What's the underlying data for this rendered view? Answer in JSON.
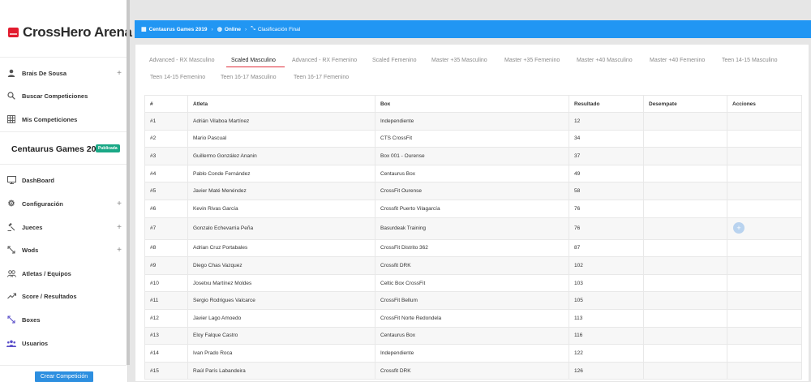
{
  "brand": {
    "name": "CrossHero Arena"
  },
  "sidebar": {
    "user_name": "Brais De Sousa",
    "search_label": "Buscar Competiciones",
    "my_comps_label": "Mis Competiciones",
    "competition_title": "Centaurus Games 2019",
    "competition_badge": "Publicada",
    "items": [
      {
        "label": "DashBoard",
        "icon": "monitor-icon",
        "expandable": false
      },
      {
        "label": "Configuración",
        "icon": "gear-icon",
        "expandable": true
      },
      {
        "label": "Jueces",
        "icon": "gavel-icon",
        "expandable": true
      },
      {
        "label": "Wods",
        "icon": "expand-arrows-icon",
        "expandable": true
      },
      {
        "label": "Atletas / Equipos",
        "icon": "people-icon",
        "expandable": false
      },
      {
        "label": "Score / Resultados",
        "icon": "trending-icon",
        "expandable": false
      },
      {
        "label": "Boxes",
        "icon": "box-arrows-icon",
        "expandable": false
      },
      {
        "label": "Usuarios",
        "icon": "group-icon",
        "expandable": false
      }
    ],
    "create_button": "Crear Competición"
  },
  "breadcrumb": {
    "competition": "Centaurus Games 2019",
    "mode": "Online",
    "current": "Clasificación Final"
  },
  "tabs": [
    {
      "label": "Advanced - RX Masculino",
      "active": false
    },
    {
      "label": "Scaled Masculino",
      "active": true
    },
    {
      "label": "Advanced - RX Femenino",
      "active": false
    },
    {
      "label": "Scaled Femenino",
      "active": false
    },
    {
      "label": "Master +35 Masculino",
      "active": false
    },
    {
      "label": "Master +35 Femenino",
      "active": false
    },
    {
      "label": "Master +40 Masculino",
      "active": false
    },
    {
      "label": "Master +40 Femenino",
      "active": false
    },
    {
      "label": "Teen 14-15 Masculino",
      "active": false
    },
    {
      "label": "Teen 14-15 Femenino",
      "active": false
    },
    {
      "label": "Teen 16-17 Masculino",
      "active": false
    },
    {
      "label": "Teen 16-17 Femenino",
      "active": false
    }
  ],
  "table": {
    "headers": [
      "#",
      "Atleta",
      "Box",
      "Resultado",
      "Desempate",
      "Acciones"
    ],
    "rows": [
      {
        "pos": "#1",
        "athlete": "Adrián Vilaboa Martínez",
        "box": "Independiente",
        "result": "12"
      },
      {
        "pos": "#2",
        "athlete": "Mario Pascual",
        "box": "CTS CrossFit",
        "result": "34"
      },
      {
        "pos": "#3",
        "athlete": "Guillermo González Ananin",
        "box": "Box 001 - Ourense",
        "result": "37"
      },
      {
        "pos": "#4",
        "athlete": "Pablo Conde Fernández",
        "box": "Centaurus Box",
        "result": "49"
      },
      {
        "pos": "#5",
        "athlete": "Javier Maté Menéndez",
        "box": "CrossFit Ourense",
        "result": "58"
      },
      {
        "pos": "#6",
        "athlete": "Kevin Rivas García",
        "box": "Crossfit Puerto Vilagarcía",
        "result": "76"
      },
      {
        "pos": "#7",
        "athlete": "Gonzalo Echevarria Peña",
        "box": "Basurdeak Training",
        "result": "76"
      },
      {
        "pos": "#8",
        "athlete": "Adrian Cruz Portabales",
        "box": "CrossFit Distrito 362",
        "result": "87"
      },
      {
        "pos": "#9",
        "athlete": "Diego Chas Vazquez",
        "box": "Crossfit DRK",
        "result": "102"
      },
      {
        "pos": "#10",
        "athlete": "Josetxu Martínez Moldes",
        "box": "Celtic Box CrossFit",
        "result": "103"
      },
      {
        "pos": "#11",
        "athlete": "Sergio Rodrigues Valcarce",
        "box": "CrossFit Bellum",
        "result": "105"
      },
      {
        "pos": "#12",
        "athlete": "Javier Lago Amoedo",
        "box": "CrossFit Norte Redondela",
        "result": "113"
      },
      {
        "pos": "#13",
        "athlete": "Eloy Falque Castro",
        "box": "Centaurus Box",
        "result": "116"
      },
      {
        "pos": "#14",
        "athlete": "Ivan Prado Roca",
        "box": "Independiente",
        "result": "122"
      },
      {
        "pos": "#15",
        "athlete": "Raúl París Labandeira",
        "box": "Crossfit DRK",
        "result": "126"
      }
    ]
  },
  "colors": {
    "primary": "#2196f3",
    "brand_red": "#e21b2e",
    "badge_green": "#1aa886",
    "tab_underline": "#e0303b"
  }
}
